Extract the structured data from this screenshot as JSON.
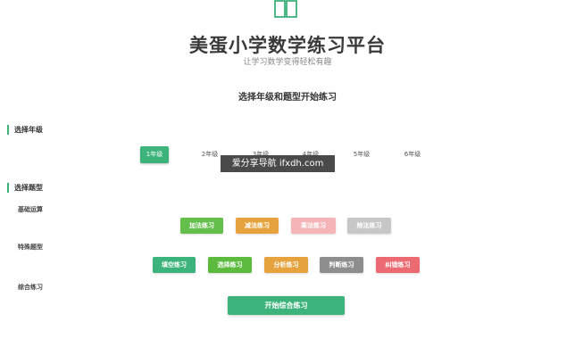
{
  "header": {
    "logo_icon": "open-book-icon",
    "title": "美蛋小学数学练习平台",
    "subtitle": "让学习数学变得轻松有趣",
    "prompt": "选择年级和题型开始练习"
  },
  "grade_section": {
    "label": "选择年级",
    "grades": [
      "1年级",
      "2年级",
      "3年级",
      "4年级",
      "5年级",
      "6年级"
    ],
    "selected": "1年级"
  },
  "type_section": {
    "label": "选择题型",
    "basic": {
      "label": "基础运算",
      "buttons": [
        "加法练习",
        "减法练习",
        "乘法练习",
        "除法练习"
      ]
    },
    "special": {
      "label": "特殊题型",
      "buttons": [
        "填空练习",
        "选择练习",
        "分析练习",
        "判断练习",
        "纠错练习"
      ]
    },
    "combined": {
      "label": "综合练习",
      "start_button": "开始综合练习"
    }
  },
  "watermark": "爱分享导航 ifxdh.com",
  "colors": {
    "accent": "#3bb37a",
    "green": "#63be4a",
    "orange": "#e6a23c",
    "pink": "#f4b4b8",
    "gray": "#c7c7c7",
    "teal": "#3bb37a",
    "olive": "#5cbb3f",
    "amber": "#e6a23c",
    "dark-gray": "#8e8e8e",
    "red": "#ec6b73"
  }
}
